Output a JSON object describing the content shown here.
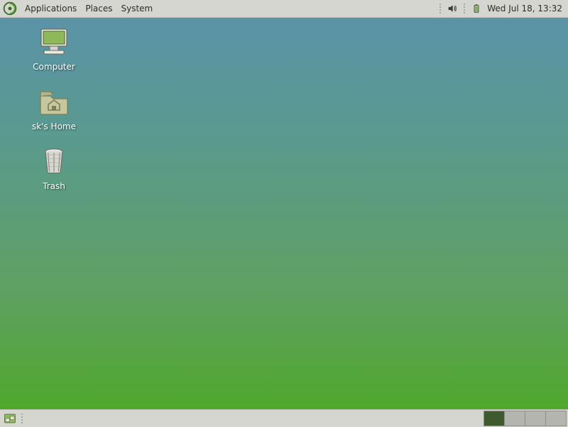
{
  "top_panel": {
    "menus": {
      "applications": "Applications",
      "places": "Places",
      "system": "System"
    },
    "clock": "Wed Jul 18, 13:32"
  },
  "desktop_icons": {
    "computer": {
      "label": "Computer"
    },
    "home": {
      "label": "sk's Home"
    },
    "trash": {
      "label": "Trash"
    }
  },
  "bottom_panel": {
    "workspaces": {
      "count": 4,
      "active_index": 0
    }
  }
}
